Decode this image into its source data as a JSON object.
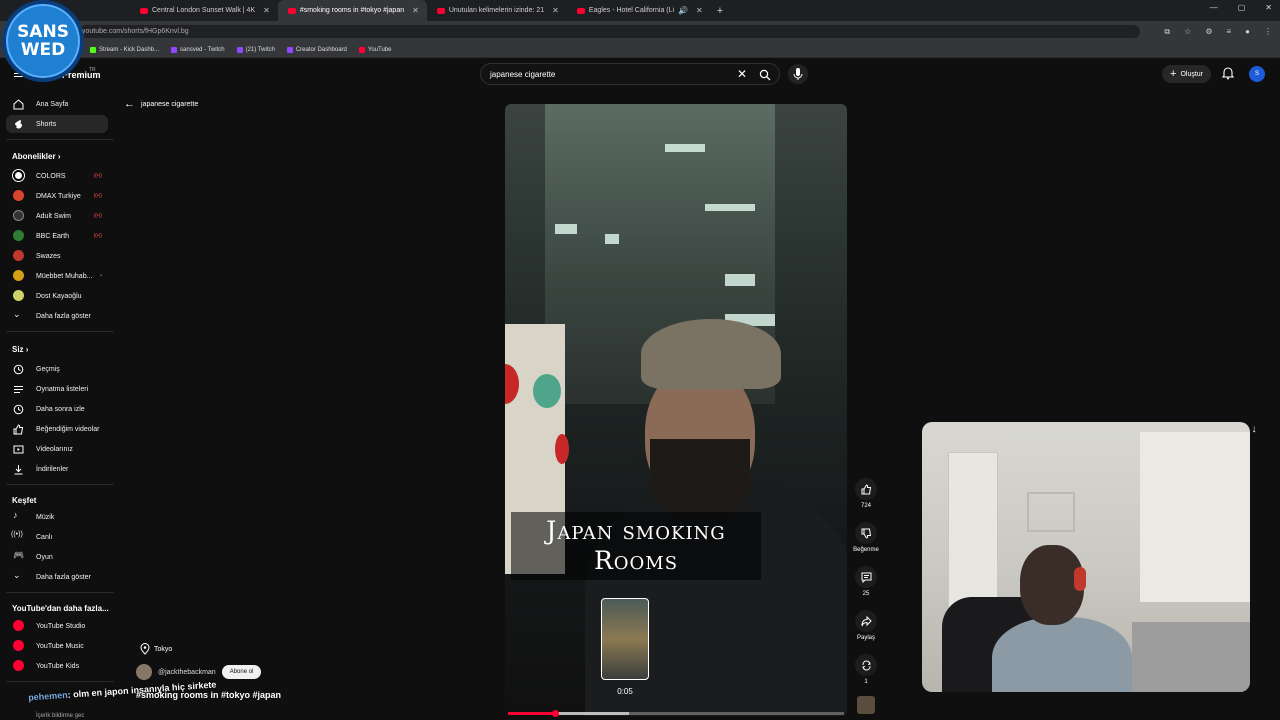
{
  "browser": {
    "tabs": [
      {
        "label": "Central London Sunset Walk | 4K",
        "active": false
      },
      {
        "label": "#smoking rooms in #tokyo #japan",
        "active": true
      },
      {
        "label": "Unutulan kelimelerin izinde: 21",
        "active": false
      },
      {
        "label": "Eagles - Hotel California (Li",
        "active": false
      }
    ],
    "url": "youtube.com/shorts/fHGp6Knvl.bg",
    "bookmarks": [
      {
        "label": "Stream - Kick Dashb...",
        "color": "#53fc18"
      },
      {
        "label": "sansved - Twitch",
        "color": "#9146ff"
      },
      {
        "label": "(21) Twitch",
        "color": "#9146ff"
      },
      {
        "label": "Creator Dashboard",
        "color": "#9146ff"
      },
      {
        "label": "YouTube",
        "color": "#ff0033"
      }
    ]
  },
  "stream_logo": {
    "line1": "SANS",
    "line2": "WED"
  },
  "header": {
    "logo_text": "Premium",
    "logo_region": "TR",
    "search_value": "japanese cigarette",
    "create_label": "Oluştur",
    "profile_initial": "S"
  },
  "sidebar": {
    "main": [
      {
        "label": "Ana Sayfa",
        "icon": "home-icon",
        "active": false
      },
      {
        "label": "Shorts",
        "icon": "shorts-icon",
        "active": true
      }
    ],
    "subs_heading": "Abonelikler",
    "subscriptions": [
      {
        "label": "COLORS",
        "color": "#ffffff",
        "live": true
      },
      {
        "label": "DMAX Turkiye",
        "color": "#d8452e",
        "live": true
      },
      {
        "label": "Adult Swim",
        "color": "#333333",
        "live": true
      },
      {
        "label": "BBC Earth",
        "color": "#2e7d32",
        "live": true
      },
      {
        "label": "Swazes",
        "color": "#c0392b",
        "live": false
      },
      {
        "label": "Müebbet Muhab...",
        "color": "#d4a017",
        "live": false
      },
      {
        "label": "Dost Kayaoğlu",
        "color": "#cdd36a",
        "live": false
      }
    ],
    "subs_more": "Daha fazla göster",
    "you_heading": "Siz",
    "you": [
      {
        "label": "Geçmiş",
        "icon": "history-icon"
      },
      {
        "label": "Oynatma listeleri",
        "icon": "playlist-icon"
      },
      {
        "label": "Daha sonra izle",
        "icon": "clock-icon"
      },
      {
        "label": "Beğendiğim videolar",
        "icon": "thumbs-up-icon"
      },
      {
        "label": "Videolarınız",
        "icon": "video-icon"
      },
      {
        "label": "İndirilenler",
        "icon": "download-icon"
      }
    ],
    "explore_heading": "Keşfet",
    "explore": [
      {
        "label": "Müzik",
        "icon": "music-icon"
      },
      {
        "label": "Canlı",
        "icon": "live-icon"
      },
      {
        "label": "Oyun",
        "icon": "game-icon"
      }
    ],
    "explore_more": "Daha fazla göster",
    "more_heading": "YouTube'dan daha fazla...",
    "more": [
      {
        "label": "YouTube Studio",
        "icon": "studio-icon"
      },
      {
        "label": "YouTube Music",
        "icon": "yt-music-icon"
      },
      {
        "label": "YouTube Kids",
        "icon": "yt-kids-icon"
      }
    ]
  },
  "shorts": {
    "back_label": "japanese cigarette",
    "video_title_line1": "Japan smoking",
    "video_title_line2": "Rooms",
    "time": "0:05",
    "progress": 0.14,
    "buffered": 0.36,
    "location": "Tokyo",
    "channel": "@jackthebackman",
    "subscribe_label": "Abone ol",
    "overlay_comment_prefix": "pehemen",
    "overlay_comment": ": olm en japon insanıyla hiç sirkete",
    "title": "#smoking rooms in #tokyo #japan",
    "footer": "İçerik bildirme gec"
  },
  "actions": [
    {
      "name": "like",
      "icon": "thumbs-up-icon",
      "label": "724"
    },
    {
      "name": "dislike",
      "icon": "thumbs-down-icon",
      "label": "Beğenme"
    },
    {
      "name": "comments",
      "icon": "comment-icon",
      "label": "25"
    },
    {
      "name": "share",
      "icon": "share-icon",
      "label": "Paylaş"
    },
    {
      "name": "remix",
      "icon": "remix-icon",
      "label": "1"
    }
  ]
}
